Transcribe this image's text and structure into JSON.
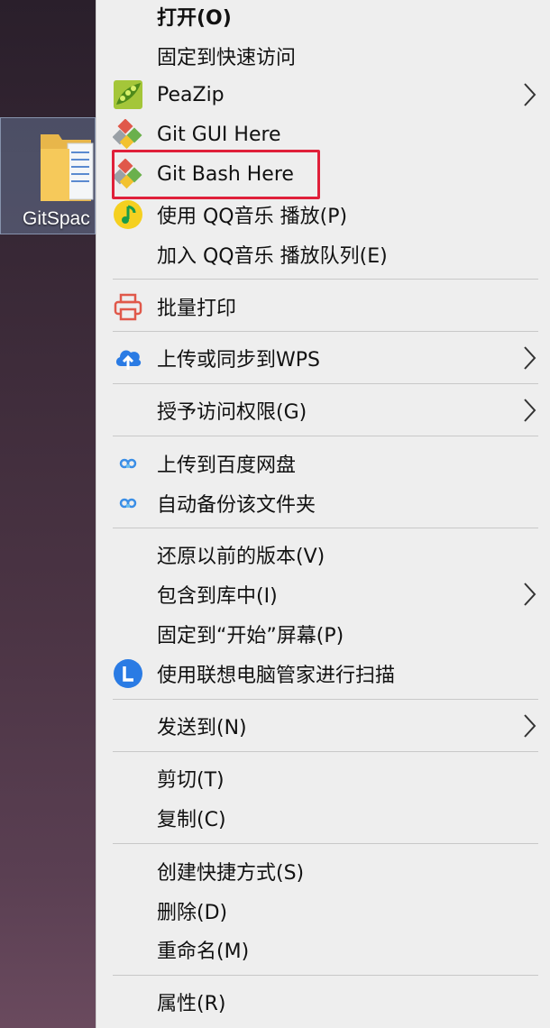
{
  "desktop": {
    "folder_label": "GitSpac"
  },
  "menu": {
    "items": [
      {
        "label": "打开(O)"
      },
      {
        "label": "固定到快速访问"
      },
      {
        "label": "PeaZip"
      },
      {
        "label": "Git GUI Here"
      },
      {
        "label": "Git Bash Here"
      },
      {
        "label": "使用 QQ音乐 播放(P)"
      },
      {
        "label": "加入 QQ音乐 播放队列(E)"
      },
      {
        "label": "批量打印"
      },
      {
        "label": "上传或同步到WPS"
      },
      {
        "label": "授予访问权限(G)"
      },
      {
        "label": "上传到百度网盘"
      },
      {
        "label": "自动备份该文件夹"
      },
      {
        "label": "还原以前的版本(V)"
      },
      {
        "label": "包含到库中(I)"
      },
      {
        "label": "固定到“开始”屏幕(P)"
      },
      {
        "label": "使用联想电脑管家进行扫描"
      },
      {
        "label": "发送到(N)"
      },
      {
        "label": "剪切(T)"
      },
      {
        "label": "复制(C)"
      },
      {
        "label": "创建快捷方式(S)"
      },
      {
        "label": "删除(D)"
      },
      {
        "label": "重命名(M)"
      },
      {
        "label": "属性(R)"
      }
    ]
  },
  "colors": {
    "highlight_border": "#e0203a",
    "menu_background": "#eeeeee"
  },
  "icons": {
    "peazip": "peazip-icon",
    "git_gui": "git-icon",
    "git_bash": "git-icon",
    "qq_music": "qq-music-icon",
    "print": "printer-icon",
    "wps": "cloud-upload-icon",
    "baidu": "baidu-netdisk-icon",
    "lenovo": "lenovo-icon",
    "submenu": "chevron-right-icon"
  }
}
